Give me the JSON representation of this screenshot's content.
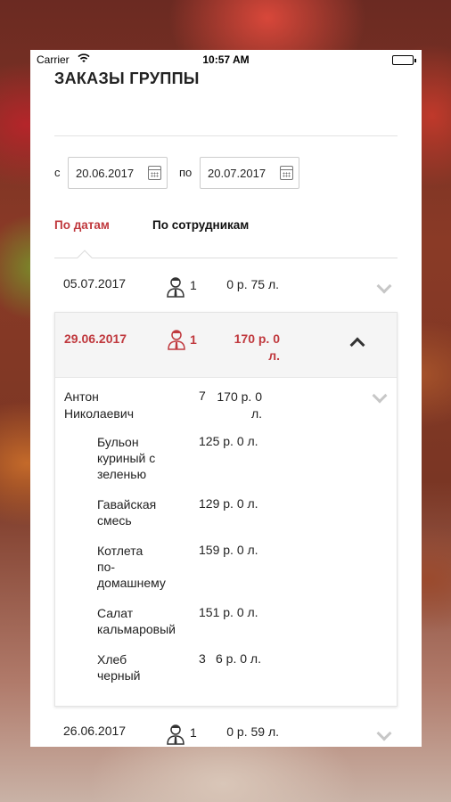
{
  "status_bar": {
    "carrier": "Carrier",
    "time": "10:57 AM"
  },
  "page_title": "ЗАКАЗЫ ГРУППЫ",
  "filter": {
    "from_label": "с",
    "from_value": "20.06.2017",
    "to_label": "по",
    "to_value": "20.07.2017"
  },
  "tabs": [
    {
      "label": "По датам",
      "active": true
    },
    {
      "label": "По сотрудникам",
      "active": false
    }
  ],
  "orders": [
    {
      "date": "05.07.2017",
      "count": "1",
      "sum": "0 р. 75 л.",
      "expanded": false
    },
    {
      "date": "29.06.2017",
      "count": "1",
      "sum_line1": "170 р. 0",
      "sum_line2": "л.",
      "expanded": true,
      "employee": {
        "name_line1": "Антон",
        "name_line2": "Николаевич",
        "count": "7",
        "sum_line1": "170 р. 0",
        "sum_line2": "л.",
        "dishes": [
          {
            "name": [
              "Бульон",
              "куриный с",
              "зеленью"
            ],
            "qty": "",
            "price": "125 р. 0 л."
          },
          {
            "name": [
              "Гавайская",
              "смесь"
            ],
            "qty": "",
            "price": "129 р. 0 л."
          },
          {
            "name": [
              "Котлета",
              "по-",
              "домашнему"
            ],
            "qty": "",
            "price": "159 р. 0 л."
          },
          {
            "name": [
              "Салат",
              "кальмаровый"
            ],
            "qty": "",
            "price": "151 р. 0 л."
          },
          {
            "name": [
              "Хлеб",
              "черный"
            ],
            "qty": "3",
            "price": "6 р. 0 л."
          }
        ]
      }
    },
    {
      "date": "26.06.2017",
      "count": "1",
      "sum": "0 р. 59 л.",
      "expanded": false
    }
  ],
  "colors": {
    "accent": "#c0393e",
    "chevron": "#c7c7c7"
  },
  "icons": {
    "wifi": "wifi-icon",
    "battery": "battery-icon",
    "calendar": "calendar-icon",
    "person": "person-icon",
    "chevron_down": "chevron-down-icon",
    "chevron_up": "chevron-up-icon"
  }
}
